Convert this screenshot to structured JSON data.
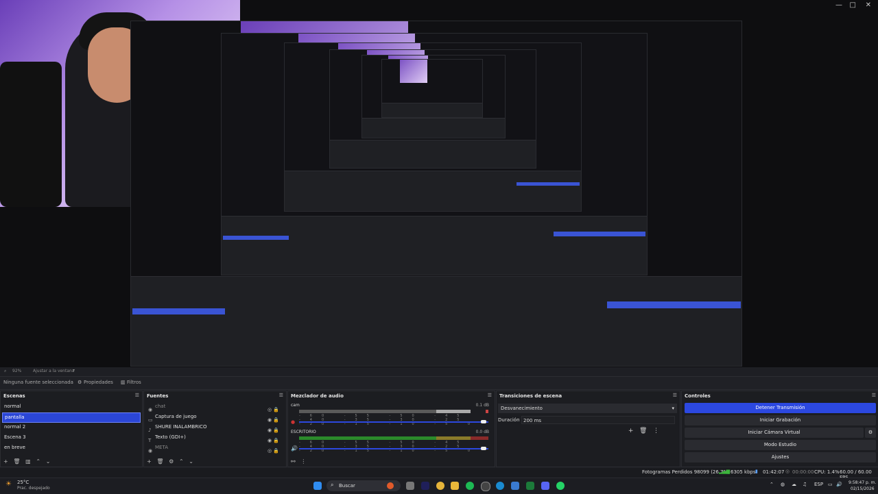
{
  "window": {
    "min": "—",
    "max": "□",
    "close": "✕"
  },
  "preview": {
    "zoom_label": "92%",
    "fit_label": "Ajustar a la ventana"
  },
  "prop_bar": {
    "no_source": "Ninguna fuente seleccionada",
    "properties": "Propiedades",
    "filters": "Filtros"
  },
  "scenes": {
    "title": "Escenas",
    "items": [
      "normal",
      "pantalla",
      "normal 2",
      "Escena 3",
      "en breve"
    ],
    "selected_index": 1
  },
  "sources": {
    "title": "Fuentes",
    "items": [
      "chat",
      "Captura de juego",
      "SHURE INALAMBRICO",
      "Texto (GDI+)",
      "META"
    ]
  },
  "mixer": {
    "title": "Mezclador de audio",
    "channels": [
      {
        "name": "cam",
        "db": "0.1 dB"
      },
      {
        "name": "ESCRITORIO",
        "db": "0.0 dB"
      }
    ],
    "ticks": "-60 -55 -50 -45 -40 -35 -30 -25 -20 -15 -10 -5 0"
  },
  "transitions": {
    "title": "Transiciones de escena",
    "selected": "Desvanecimiento",
    "duration_label": "Duración",
    "duration_value": "200 ms"
  },
  "controls": {
    "title": "Controles",
    "stop_stream": "Detener Transmisión",
    "start_recording": "Iniciar Grabación",
    "start_virtual_cam": "Iniciar Cámara Virtual",
    "studio_mode": "Modo Estudio",
    "settings": "Ajustes"
  },
  "status": {
    "dropped_frames": "Fotogramas Perdidos 98099 (26.7%)",
    "bitrate": "6305 kbps",
    "stream_time": "01:42:07",
    "rec_time": "00:00:00",
    "cpu": "CPU: 1.4%",
    "fps": "60.00 / 60.00 FPS"
  },
  "taskbar": {
    "weather_temp": "25°C",
    "weather_desc": "Prac. despejado",
    "search": "Buscar",
    "lang": "ESP",
    "time": "9:58:47 p. m.",
    "date": "02/15/2026"
  },
  "colors": {
    "accent": "#2c48e0",
    "meter_green": "#2b8a2b",
    "meter_yellow": "#8a7a2a",
    "meter_red": "#8a2a2a"
  }
}
